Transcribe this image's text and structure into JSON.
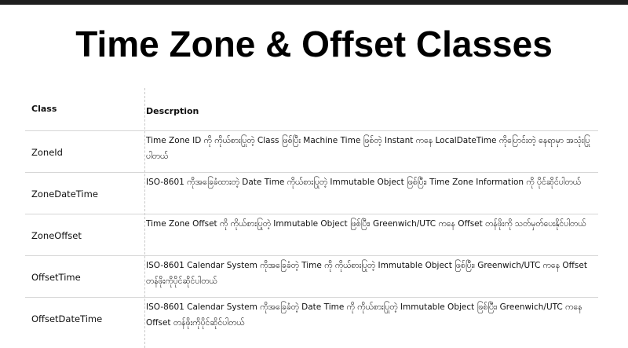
{
  "page": {
    "title": "Time Zone & Offset Classes"
  },
  "table": {
    "headers": {
      "class": "Class",
      "description": "Descrption"
    },
    "rows": [
      {
        "class": "ZoneId",
        "description": "Time Zone ID ကို ကိုယ်စားပြုတဲ့ Class ဖြစ်ပြီး Machine Time ဖြစ်တဲ့ Instant ကနေ LocalDateTime ကိုပြောင်းတဲ့ နေရာမှာ အသုံးပြုပါတယ်"
      },
      {
        "class": "ZoneDateTime",
        "description": "ISO-8601 ကိုအခြေခံထားတဲ့ Date Time ကိုယ်စားပြုတဲ့ Immutable Object ဖြစ်ပြီး၊ Time Zone Information ကို ပိုင်ဆိုင်ပါတယ်"
      },
      {
        "class": "ZoneOffset",
        "description": "Time Zone Offset ကို ကိုယ်စားပြုတဲ့ Immutable Object ဖြစ်ပြီး၊ Greenwich/UTC ကနေ Offset တန်ဖိုးကို သတ်မှတ်ပေးနိုင်ပါတယ်"
      },
      {
        "class": "OffsetTime",
        "description": "ISO-8601 Calendar System ကိုအခြေခံတဲ့ Time ကို ကိုယ်စားပြုတဲ့ Immutable Object ဖြစ်ပြီး၊ Greenwich/UTC ကနေ Offset တန်ဖိုးကိုပိုင်ဆိုင်ပါတယ်"
      },
      {
        "class": "OffsetDateTime",
        "description": "ISO-8601 Calendar System ကိုအခြေခံတဲ့ Date Time ကို ကိုယ်စားပြုတဲ့ Immutable Object ဖြစ်ပြီး၊ Greenwich/UTC ကနေ Offset တန်ဖိုးကိုပိုင်ဆိုင်ပါတယ်"
      }
    ]
  }
}
